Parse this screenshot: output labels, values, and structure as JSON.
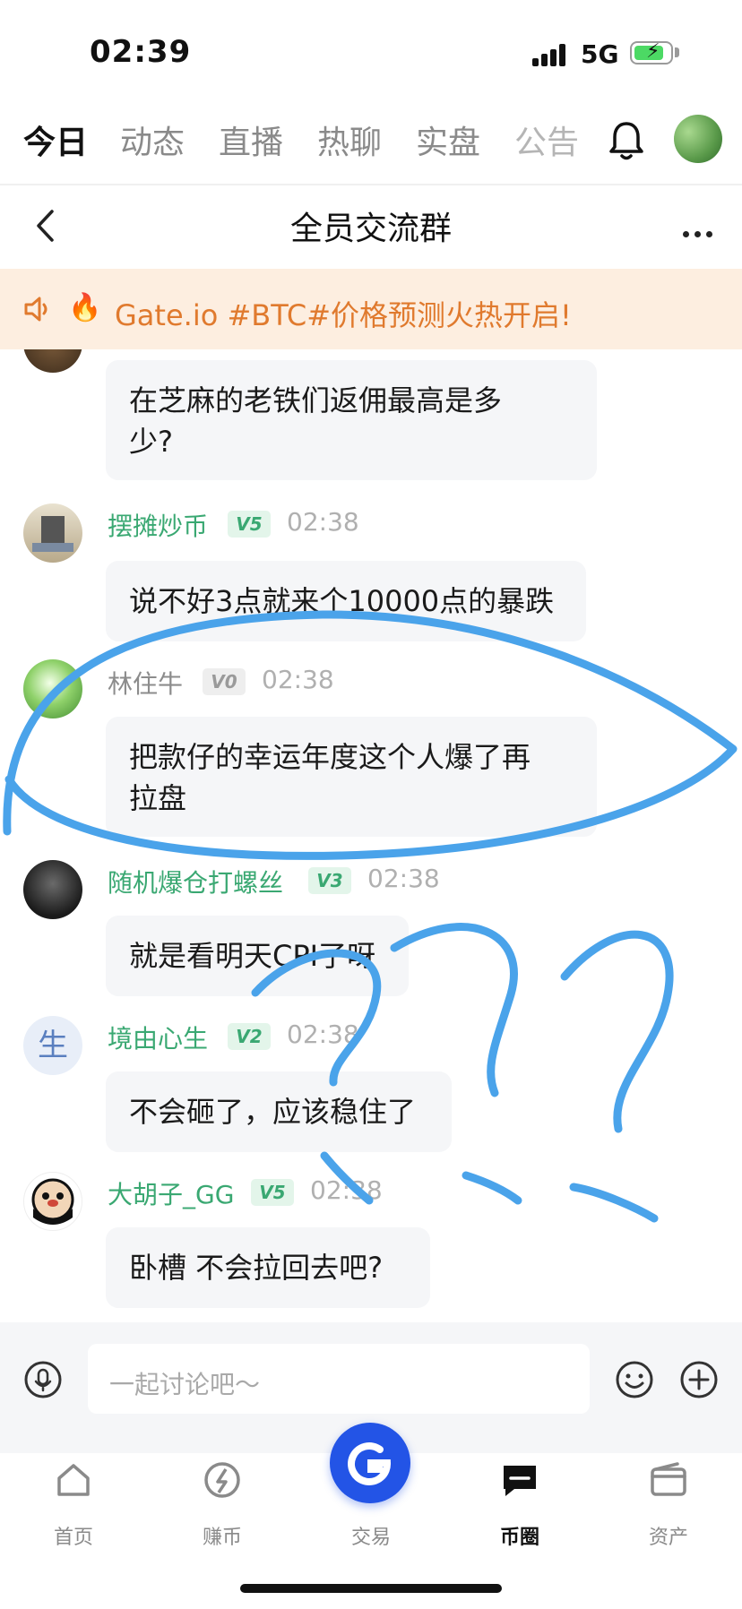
{
  "status_bar": {
    "time": "02:39",
    "network": "5G"
  },
  "tabs": [
    {
      "label": "今日"
    },
    {
      "label": "动态"
    },
    {
      "label": "直播"
    },
    {
      "label": "热聊"
    },
    {
      "label": "实盘"
    },
    {
      "label": "公告"
    }
  ],
  "header": {
    "title": "全员交流群"
  },
  "notice": {
    "text": "Gate.io #BTC#价格预测火热开启!"
  },
  "messages": [
    {
      "text_lines": [
        "在芝麻的老铁们返佣最高是多",
        "少?"
      ]
    },
    {
      "name": "摆摊炒币",
      "badge": "V5",
      "time": "02:38",
      "text": "说不好3点就来个10000点的暴跌"
    },
    {
      "name": "林住牛",
      "badge": "V0",
      "time": "02:38",
      "text_lines": [
        "把款仔的幸运年度这个人爆了再",
        "拉盘"
      ]
    },
    {
      "name": "随机爆仓打螺丝",
      "badge": "V3",
      "time": "02:38",
      "text": "就是看明天CPI了呀"
    },
    {
      "name": "境由心生",
      "badge": "V2",
      "time": "02:38",
      "avatar_char": "生",
      "text": "不会砸了，应该稳住了"
    },
    {
      "name": "大胡子_GG",
      "badge": "V5",
      "time": "02:38",
      "text": "卧槽 不会拉回去吧?"
    }
  ],
  "input": {
    "placeholder": "一起讨论吧～"
  },
  "bottom_nav": [
    {
      "label": "首页"
    },
    {
      "label": "赚币"
    },
    {
      "label": "交易"
    },
    {
      "label": "币圈"
    },
    {
      "label": "资产"
    }
  ],
  "colors": {
    "accent": "#2354e6",
    "username": "#3aa872",
    "notice_bg": "#fdeee0",
    "notice_text": "#e07a2e",
    "annotation": "#4aa3ea"
  }
}
